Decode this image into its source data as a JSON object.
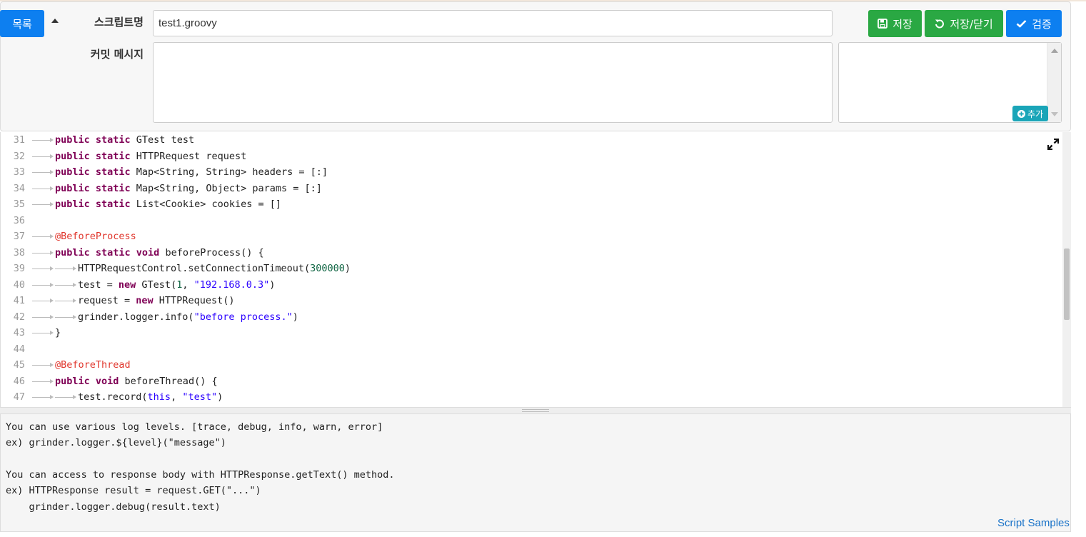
{
  "header": {
    "list_button": "목록",
    "script_name_label": "스크립트명",
    "script_name_value": "test1.groovy",
    "commit_label": "커밋 메시지",
    "commit_value": "",
    "add_button": "추가",
    "save_button": "저장",
    "save_close_button": "저장/닫기",
    "validate_button": "검증"
  },
  "editor": {
    "lines": [
      {
        "n": "31",
        "tabs": 1,
        "tokens": [
          [
            "kw",
            "public static"
          ],
          [
            "pl",
            " GTest test"
          ]
        ]
      },
      {
        "n": "32",
        "tabs": 1,
        "tokens": [
          [
            "kw",
            "public static"
          ],
          [
            "pl",
            " HTTPRequest request"
          ]
        ]
      },
      {
        "n": "33",
        "tabs": 1,
        "tokens": [
          [
            "kw",
            "public static"
          ],
          [
            "pl",
            " Map<String, String> headers = [:]"
          ]
        ]
      },
      {
        "n": "34",
        "tabs": 1,
        "tokens": [
          [
            "kw",
            "public static"
          ],
          [
            "pl",
            " Map<String, Object> params = [:]"
          ]
        ]
      },
      {
        "n": "35",
        "tabs": 1,
        "tokens": [
          [
            "kw",
            "public static"
          ],
          [
            "pl",
            " List<Cookie> cookies = []"
          ]
        ]
      },
      {
        "n": "36",
        "tabs": 0,
        "tokens": []
      },
      {
        "n": "37",
        "tabs": 1,
        "tokens": [
          [
            "an",
            "@BeforeProcess"
          ]
        ]
      },
      {
        "n": "38",
        "tabs": 1,
        "tokens": [
          [
            "kw",
            "public static void"
          ],
          [
            "pl",
            " beforeProcess() {"
          ]
        ]
      },
      {
        "n": "39",
        "tabs": 2,
        "tokens": [
          [
            "pl",
            "HTTPRequestControl.setConnectionTimeout("
          ],
          [
            "nm",
            "300000"
          ],
          [
            "pl",
            ")"
          ]
        ]
      },
      {
        "n": "40",
        "tabs": 2,
        "tokens": [
          [
            "pl",
            "test = "
          ],
          [
            "kw",
            "new"
          ],
          [
            "pl",
            " GTest("
          ],
          [
            "nm",
            "1"
          ],
          [
            "pl",
            ", "
          ],
          [
            "st",
            "\"192.168.0.3\""
          ],
          [
            "pl",
            ")"
          ]
        ]
      },
      {
        "n": "41",
        "tabs": 2,
        "tokens": [
          [
            "pl",
            "request = "
          ],
          [
            "kw",
            "new"
          ],
          [
            "pl",
            " HTTPRequest()"
          ]
        ]
      },
      {
        "n": "42",
        "tabs": 2,
        "tokens": [
          [
            "pl",
            "grinder.logger.info("
          ],
          [
            "st",
            "\"before process.\""
          ],
          [
            "pl",
            ")"
          ]
        ]
      },
      {
        "n": "43",
        "tabs": 1,
        "tokens": [
          [
            "pl",
            "}"
          ]
        ]
      },
      {
        "n": "44",
        "tabs": 0,
        "tokens": []
      },
      {
        "n": "45",
        "tabs": 1,
        "tokens": [
          [
            "an",
            "@BeforeThread"
          ]
        ]
      },
      {
        "n": "46",
        "tabs": 1,
        "tokens": [
          [
            "kw",
            "public void"
          ],
          [
            "pl",
            " beforeThread() {"
          ]
        ]
      },
      {
        "n": "47",
        "tabs": 2,
        "tokens": [
          [
            "pl",
            "test.record("
          ],
          [
            "st",
            "this"
          ],
          [
            "pl",
            ", "
          ],
          [
            "st",
            "\"test\""
          ],
          [
            "pl",
            ")"
          ]
        ]
      }
    ]
  },
  "help": {
    "lines": [
      "You can use various log levels. [trace, debug, info, warn, error]",
      "ex) grinder.logger.${level}(\"message\")",
      "",
      "You can access to response body with HTTPResponse.getText() method.",
      "ex) HTTPResponse result = request.GET(\"...\")",
      "    grinder.logger.debug(result.text)"
    ],
    "script_samples_link": "Script Samples"
  },
  "colors": {
    "primary": "#0d7ff0",
    "success": "#2aa843",
    "info": "#1aa5b8",
    "keyword": "#7f0055",
    "annotation": "#e0352b",
    "string": "#2a00ff",
    "number": "#116644"
  },
  "icons": {
    "save": "floppy-disk-icon",
    "save_close": "undo-icon",
    "validate": "check-icon",
    "add": "plus-circle-icon",
    "expand": "expand-arrows-icon",
    "collapse": "caret-up-icon"
  }
}
